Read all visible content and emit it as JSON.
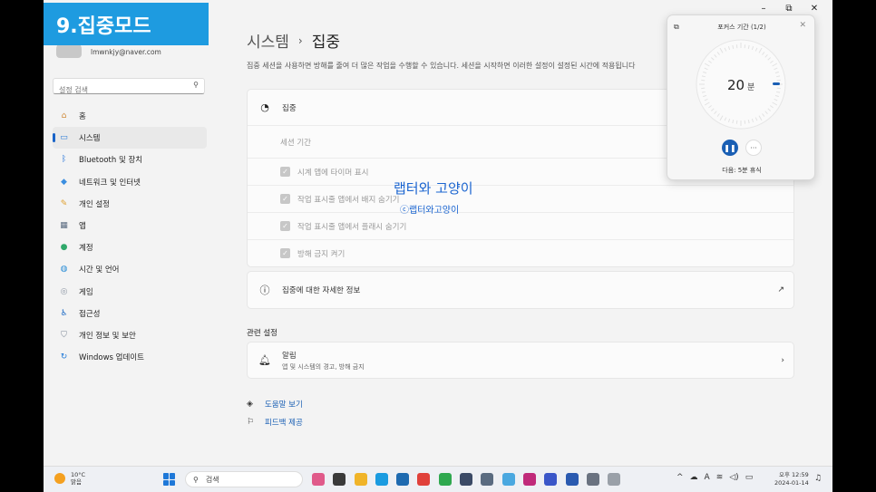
{
  "banner": {
    "title": "9.집중모드"
  },
  "window": {
    "minimize": "–",
    "restore": "⧉",
    "close": "✕"
  },
  "sidebar": {
    "email": "lmwnkjy@naver.com",
    "search_placeholder": "설정 검색",
    "items": [
      {
        "label": "홈",
        "icon": "home-icon",
        "color": "#d08b3a"
      },
      {
        "label": "시스템",
        "icon": "system-icon",
        "color": "#2a7ad6",
        "active": true
      },
      {
        "label": "Bluetooth 및 장치",
        "icon": "bluetooth-icon",
        "color": "#1e6fd8"
      },
      {
        "label": "네트워크 및 인터넷",
        "icon": "network-icon",
        "color": "#3b8ee0"
      },
      {
        "label": "개인 설정",
        "icon": "brush-icon",
        "color": "#e0a030"
      },
      {
        "label": "앱",
        "icon": "apps-icon",
        "color": "#5a6b80"
      },
      {
        "label": "계정",
        "icon": "account-icon",
        "color": "#2fa86a"
      },
      {
        "label": "시간 및 언어",
        "icon": "globe-icon",
        "color": "#2c8ed6"
      },
      {
        "label": "게임",
        "icon": "gamepad-icon",
        "color": "#8c96a4"
      },
      {
        "label": "접근성",
        "icon": "accessibility-icon",
        "color": "#1d6ac4"
      },
      {
        "label": "개인 정보 및 보안",
        "icon": "shield-icon",
        "color": "#7a8594"
      },
      {
        "label": "Windows 업데이트",
        "icon": "update-icon",
        "color": "#1e78d8"
      }
    ]
  },
  "main": {
    "breadcrumb_parent": "시스템",
    "breadcrumb_sep": "›",
    "breadcrumb_current": "집중",
    "description": "집중 세션을 사용하면 방해를 줄여 더 많은 작업을 수행할 수 있습니다. 세션을 시작하면 이러한 설정이 설정된 시간에 적용됩니다",
    "focus_card": {
      "header": "집중",
      "session_label": "세션 기간",
      "options": [
        "시계 앱에 타이머 표시",
        "작업 표시줄 앱에서 배지 숨기기",
        "작업 표시줄 앱에서 플래시 숨기기",
        "방해 금지 켜기"
      ]
    },
    "info_link": "집중에 대한 자세한 정보",
    "related_header": "관련 설정",
    "notifications": {
      "title": "알림",
      "subtitle": "앱 및 시스템의 경고, 방해 금지"
    },
    "help_link": "도움말 보기",
    "feedback_link": "피드백 제공"
  },
  "watermark": {
    "line1": "랩터와 고양이",
    "line2": "ⓒ랩터와고양이"
  },
  "focus_popup": {
    "title": "포커스 기간 (1/2)",
    "minutes": "20",
    "unit": "분",
    "progress": 0.0,
    "next": "다음: 5분 휴식"
  },
  "taskbar": {
    "temperature": "10°C",
    "weather": "맑음",
    "search_label": "검색",
    "app_colors": [
      "#e05a8a",
      "#3a3a3a",
      "#f0b429",
      "#1a9be0",
      "#1e6ab0",
      "#e0413b",
      "#2fa84f",
      "#3b4a66",
      "#5a6b80",
      "#4aa8e0",
      "#c02a7a",
      "#3a56c8",
      "#2a5ab0",
      "#6a7280",
      "#9aa0a8"
    ],
    "tray_caret": "^",
    "tray_lang": "A",
    "time": "오후 12:59",
    "date": "2024-01-14"
  }
}
